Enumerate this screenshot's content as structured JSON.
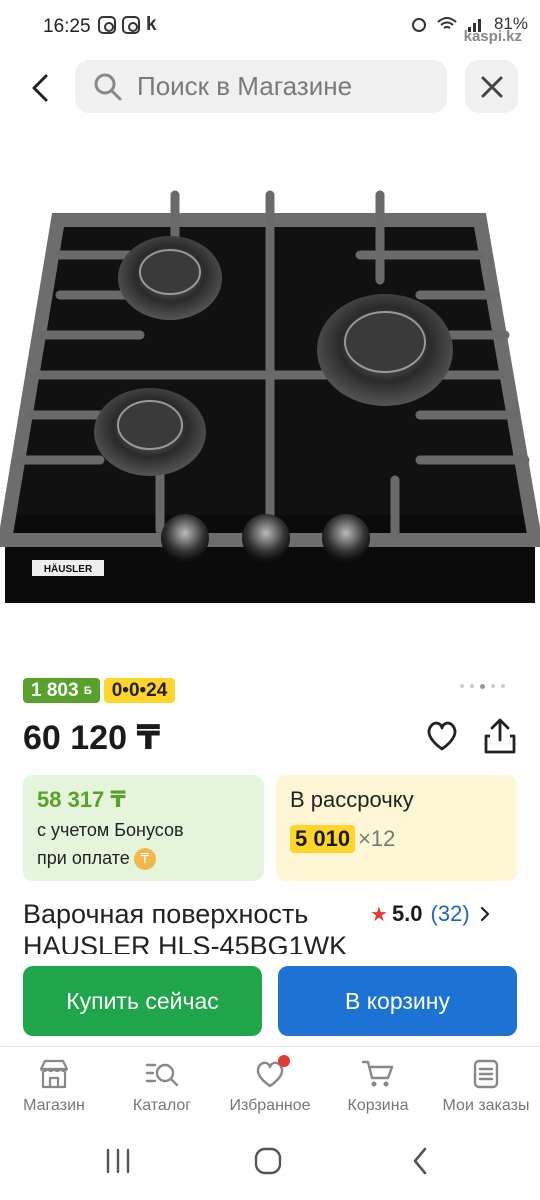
{
  "status_bar": {
    "time": "16:25",
    "battery": "81%",
    "watermark": "kaspi.kz",
    "carrier_letter": "k"
  },
  "search": {
    "placeholder": "Поиск в Магазине"
  },
  "product": {
    "bonus_badge": "1 803",
    "bonus_badge_unit": "Б",
    "installment_badge": "0•0•24",
    "price": "60 120 ₸",
    "bonus_card": {
      "price": "58 317 ₸",
      "line1": "с учетом Бонусов",
      "line2": "при оплате"
    },
    "installment_card": {
      "title": "В рассрочку",
      "amount": "5 010",
      "times": "×12"
    },
    "title": "Варочная поверхность HAUSLER HLS-45BG1WK",
    "rating": {
      "value": "5.0",
      "count": "(32)"
    },
    "brand_label": "HÄUSLER"
  },
  "actions": {
    "buy_now": "Купить сейчас",
    "add_to_cart": "В корзину"
  },
  "bottom_nav": [
    {
      "label": "Магазин",
      "icon": "store-icon"
    },
    {
      "label": "Каталог",
      "icon": "catalog-search-icon"
    },
    {
      "label": "Избранное",
      "icon": "heart-icon"
    },
    {
      "label": "Корзина",
      "icon": "cart-icon"
    },
    {
      "label": "Мои заказы",
      "icon": "orders-icon"
    }
  ],
  "colors": {
    "green": "#58a12b",
    "yellow": "#ffd529",
    "buy_green": "#1fa54a",
    "cart_blue": "#1c73d4",
    "red": "#e53935"
  }
}
